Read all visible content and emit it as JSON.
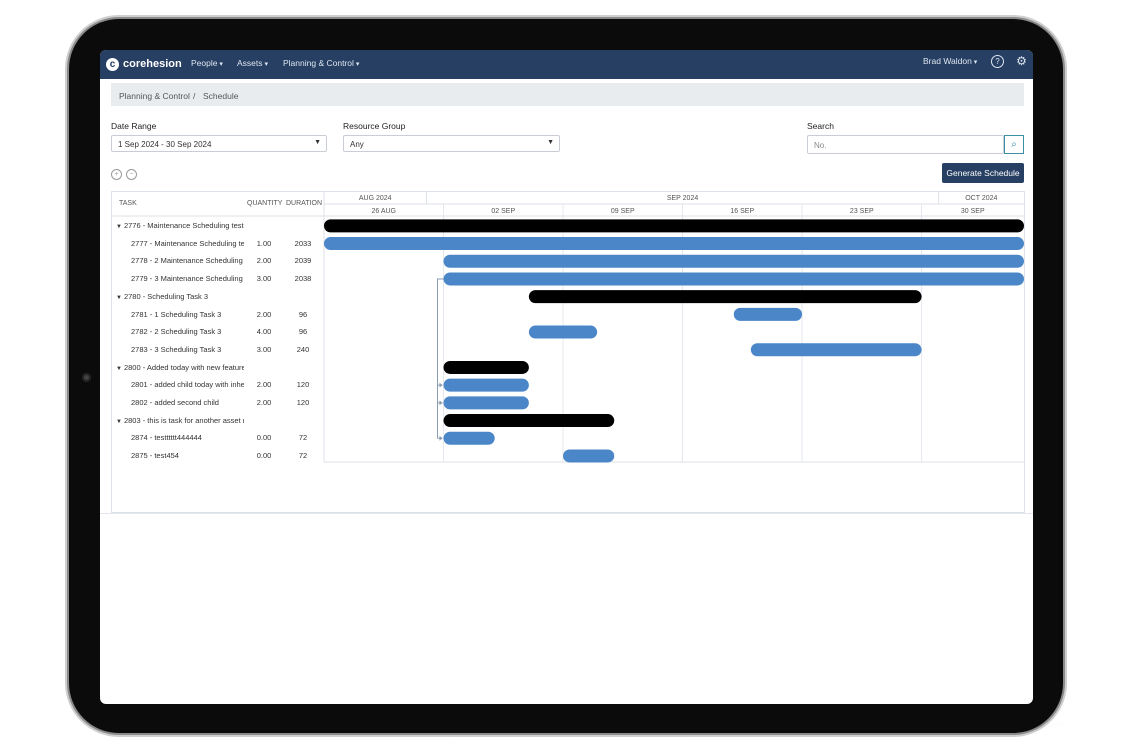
{
  "navbar": {
    "brand": "corehesion",
    "menu": [
      "People",
      "Assets",
      "Planning & Control"
    ],
    "user": "Brad Waldon"
  },
  "breadcrumb": [
    "Planning & Control",
    "/",
    "Schedule"
  ],
  "filters": {
    "date_range_label": "Date Range",
    "date_range_value": "1 Sep 2024 - 30 Sep 2024",
    "resource_group_label": "Resource Group",
    "resource_group_value": "Any",
    "search_label": "Search",
    "search_placeholder": "No."
  },
  "actions": {
    "generate_label": "Generate Schedule"
  },
  "grid": {
    "columns": {
      "task": "TASK",
      "quantity": "QUANTITY",
      "duration": "DURATION"
    },
    "rows": [
      {
        "label": "2776 - Maintenance Scheduling test t",
        "qty": "",
        "dur": "",
        "parent": true
      },
      {
        "label": "2777 - Maintenance Scheduling tes",
        "qty": "1.00",
        "dur": "2033",
        "parent": false
      },
      {
        "label": "2778 - 2 Maintenance Scheduling te",
        "qty": "2.00",
        "dur": "2039",
        "parent": false
      },
      {
        "label": "2779 - 3 Maintenance Scheduling te",
        "qty": "3.00",
        "dur": "2038",
        "parent": false
      },
      {
        "label": "2780 - Scheduling Task 3",
        "qty": "",
        "dur": "",
        "parent": true
      },
      {
        "label": "2781 - 1 Scheduling Task 3",
        "qty": "2.00",
        "dur": "96",
        "parent": false
      },
      {
        "label": "2782 - 2 Scheduling Task 3",
        "qty": "4.00",
        "dur": "96",
        "parent": false
      },
      {
        "label": "2783 - 3 Scheduling Task 3",
        "qty": "3.00",
        "dur": "240",
        "parent": false
      },
      {
        "label": "2800 - Added today with new features",
        "qty": "",
        "dur": "",
        "parent": true
      },
      {
        "label": "2801 - added child today with inheri",
        "qty": "2.00",
        "dur": "120",
        "parent": false
      },
      {
        "label": "2802 - added second child",
        "qty": "2.00",
        "dur": "120",
        "parent": false
      },
      {
        "label": "2803 - this is task for another asset re",
        "qty": "",
        "dur": "",
        "parent": true
      },
      {
        "label": "2874 - testttttt444444",
        "qty": "0.00",
        "dur": "72",
        "parent": false
      },
      {
        "label": "2875 - test454",
        "qty": "0.00",
        "dur": "72",
        "parent": false
      }
    ]
  },
  "timeline": {
    "months": [
      "AUG 2024",
      "SEP 2024",
      "OCT 2024"
    ],
    "weeks": [
      "26 AUG",
      "02 SEP",
      "09 SEP",
      "16 SEP",
      "23 SEP",
      "30 SEP"
    ]
  },
  "chart_data": {
    "type": "gantt",
    "colors": {
      "summary": "#000000",
      "task": "#4a86c8"
    },
    "axis_start": "2024-08-26",
    "axis_end": "2024-10-06",
    "bars": [
      {
        "row": 0,
        "start": "2024-08-26",
        "end": "2024-10-06",
        "kind": "summary"
      },
      {
        "row": 1,
        "start": "2024-08-26",
        "end": "2024-10-06",
        "kind": "task"
      },
      {
        "row": 2,
        "start": "2024-09-02",
        "end": "2024-10-06",
        "kind": "task"
      },
      {
        "row": 3,
        "start": "2024-09-02",
        "end": "2024-10-06",
        "kind": "task"
      },
      {
        "row": 4,
        "start": "2024-09-07",
        "end": "2024-09-30",
        "kind": "summary"
      },
      {
        "row": 5,
        "start": "2024-09-19",
        "end": "2024-09-23",
        "kind": "task"
      },
      {
        "row": 6,
        "start": "2024-09-07",
        "end": "2024-09-11",
        "kind": "task"
      },
      {
        "row": 7,
        "start": "2024-09-20",
        "end": "2024-09-30",
        "kind": "task"
      },
      {
        "row": 8,
        "start": "2024-09-02",
        "end": "2024-09-07",
        "kind": "summary"
      },
      {
        "row": 9,
        "start": "2024-09-02",
        "end": "2024-09-07",
        "kind": "task"
      },
      {
        "row": 10,
        "start": "2024-09-02",
        "end": "2024-09-07",
        "kind": "task"
      },
      {
        "row": 11,
        "start": "2024-09-02",
        "end": "2024-09-12",
        "kind": "summary"
      },
      {
        "row": 12,
        "start": "2024-09-02",
        "end": "2024-09-05",
        "kind": "task"
      },
      {
        "row": 13,
        "start": "2024-09-09",
        "end": "2024-09-12",
        "kind": "task"
      }
    ],
    "links": [
      {
        "from_row": 3,
        "to_rows": [
          9,
          10,
          12
        ]
      }
    ]
  }
}
